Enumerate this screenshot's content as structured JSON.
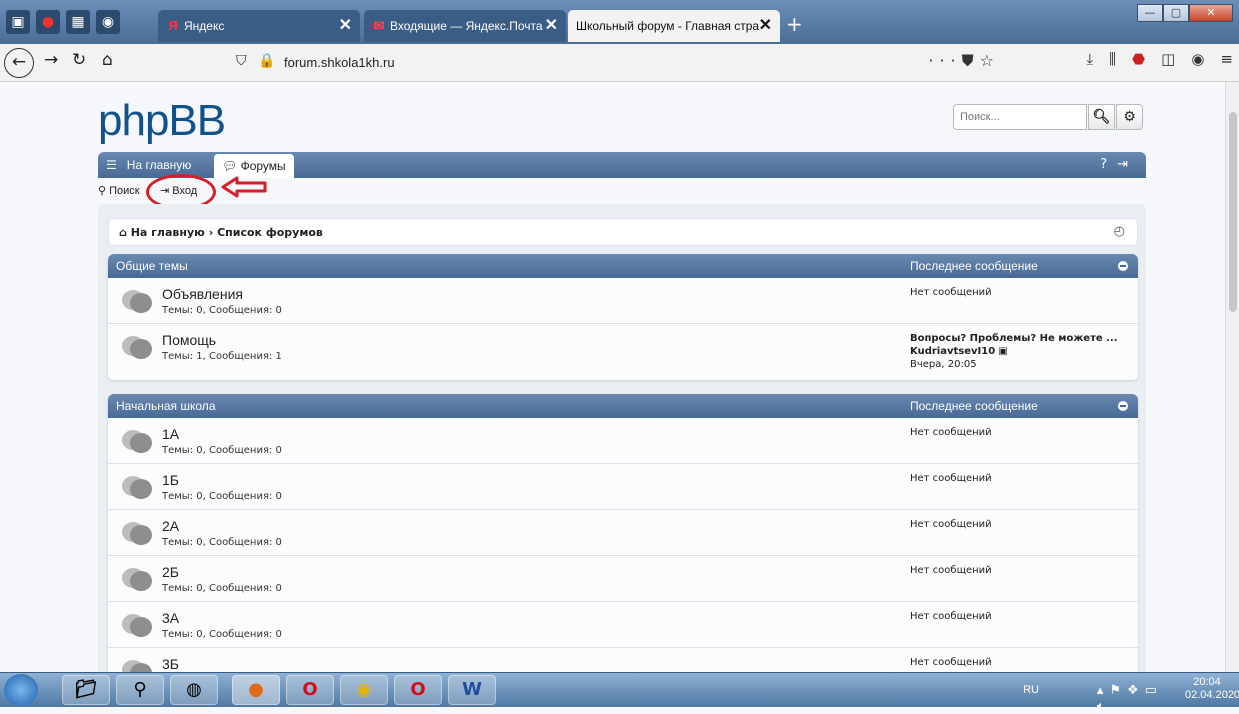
{
  "browser": {
    "tabs": [
      {
        "label": "Яндекс",
        "active": false
      },
      {
        "label": "Входящие — Яндекс.Почта",
        "active": false
      },
      {
        "label": "Школьный форум - Главная стра",
        "active": true
      }
    ],
    "url": "forum.shkola1kh.ru"
  },
  "header": {
    "logo": "phpBB",
    "search_placeholder": "Поиск..."
  },
  "nav": {
    "home_label": "На главную",
    "forums_label": "Форумы"
  },
  "subnav": {
    "search_label": "Поиск",
    "login_label": "Вход"
  },
  "breadcrumbs": {
    "home": "На главную",
    "separator": "›",
    "current": "Список форумов"
  },
  "categories": [
    {
      "title": "Общие темы",
      "last_post_header": "Последнее сообщение",
      "forums": [
        {
          "name": "Объявления",
          "stats": "Темы: 0, Сообщения: 0",
          "last_post": "Нет сообщений"
        },
        {
          "name": "Помощь",
          "stats": "Темы: 1, Сообщения: 1",
          "last_post_title": "Вопросы? Проблемы? Не можете ...",
          "last_post_author": "KudriavtsevI10",
          "last_post_time": "Вчера, 20:05"
        }
      ]
    },
    {
      "title": "Начальная школа",
      "last_post_header": "Последнее сообщение",
      "forums": [
        {
          "name": "1А",
          "stats": "Темы: 0, Сообщения: 0",
          "last_post": "Нет сообщений"
        },
        {
          "name": "1Б",
          "stats": "Темы: 0, Сообщения: 0",
          "last_post": "Нет сообщений"
        },
        {
          "name": "2А",
          "stats": "Темы: 0, Сообщения: 0",
          "last_post": "Нет сообщений"
        },
        {
          "name": "2Б",
          "stats": "Темы: 0, Сообщения: 0",
          "last_post": "Нет сообщений"
        },
        {
          "name": "3А",
          "stats": "Темы: 0, Сообщения: 0",
          "last_post": "Нет сообщений"
        },
        {
          "name": "3Б",
          "stats": "",
          "last_post": "Нет сообщений"
        }
      ]
    }
  ],
  "taskbar": {
    "lang": "RU",
    "time": "20:04",
    "date": "02.04.2020"
  },
  "colors": {
    "brand": "#105289",
    "nav_bar": "#476a95",
    "annotation_red": "#d41f2a"
  }
}
